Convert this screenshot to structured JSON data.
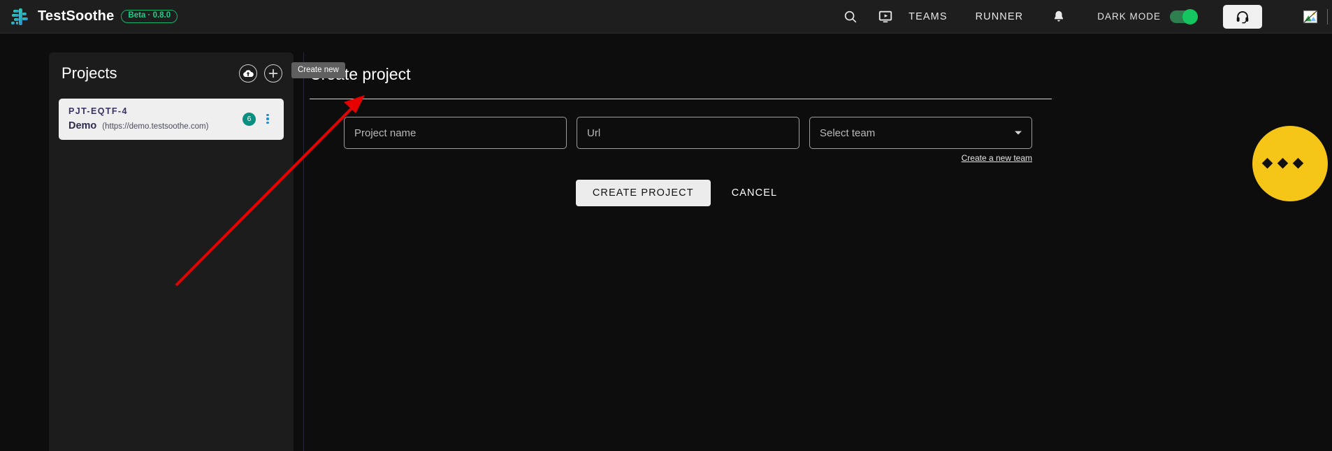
{
  "header": {
    "brand_name": "TestSoothe",
    "beta_badge": "Beta · 0.8.0",
    "nav": [
      {
        "label": "TEAMS",
        "name": "nav-teams"
      },
      {
        "label": "RUNNER",
        "name": "nav-runner"
      }
    ],
    "dark_mode_label": "DARK MODE",
    "dark_mode_on": true,
    "icons": {
      "search": "search-icon",
      "video": "video-player-icon",
      "bell": "notification-bell-icon",
      "headset": "support-headset-icon",
      "avatar": "broken-image-avatar-icon"
    }
  },
  "projects_panel": {
    "title": "Projects",
    "upload_icon": "cloud-upload-icon",
    "add_icon": "plus-icon",
    "cards": [
      {
        "code": "PJT-EQTF-4",
        "name": "Demo",
        "url": "(https://demo.testsoothe.com)",
        "count": "6"
      }
    ]
  },
  "tooltip": {
    "text": "Create new"
  },
  "create_project": {
    "title": "Create project",
    "fields": {
      "project_name_placeholder": "Project name",
      "url_placeholder": "Url",
      "team_placeholder": "Select team"
    },
    "create_team_link": "Create a new team",
    "submit_label": "CREATE PROJECT",
    "cancel_label": "CANCEL"
  },
  "colors": {
    "accent_green": "#15c55f",
    "badge_teal": "#0a9080",
    "beta_green": "#17d488",
    "annotation_red": "#e60000",
    "pacman_yellow": "#f5c518"
  }
}
